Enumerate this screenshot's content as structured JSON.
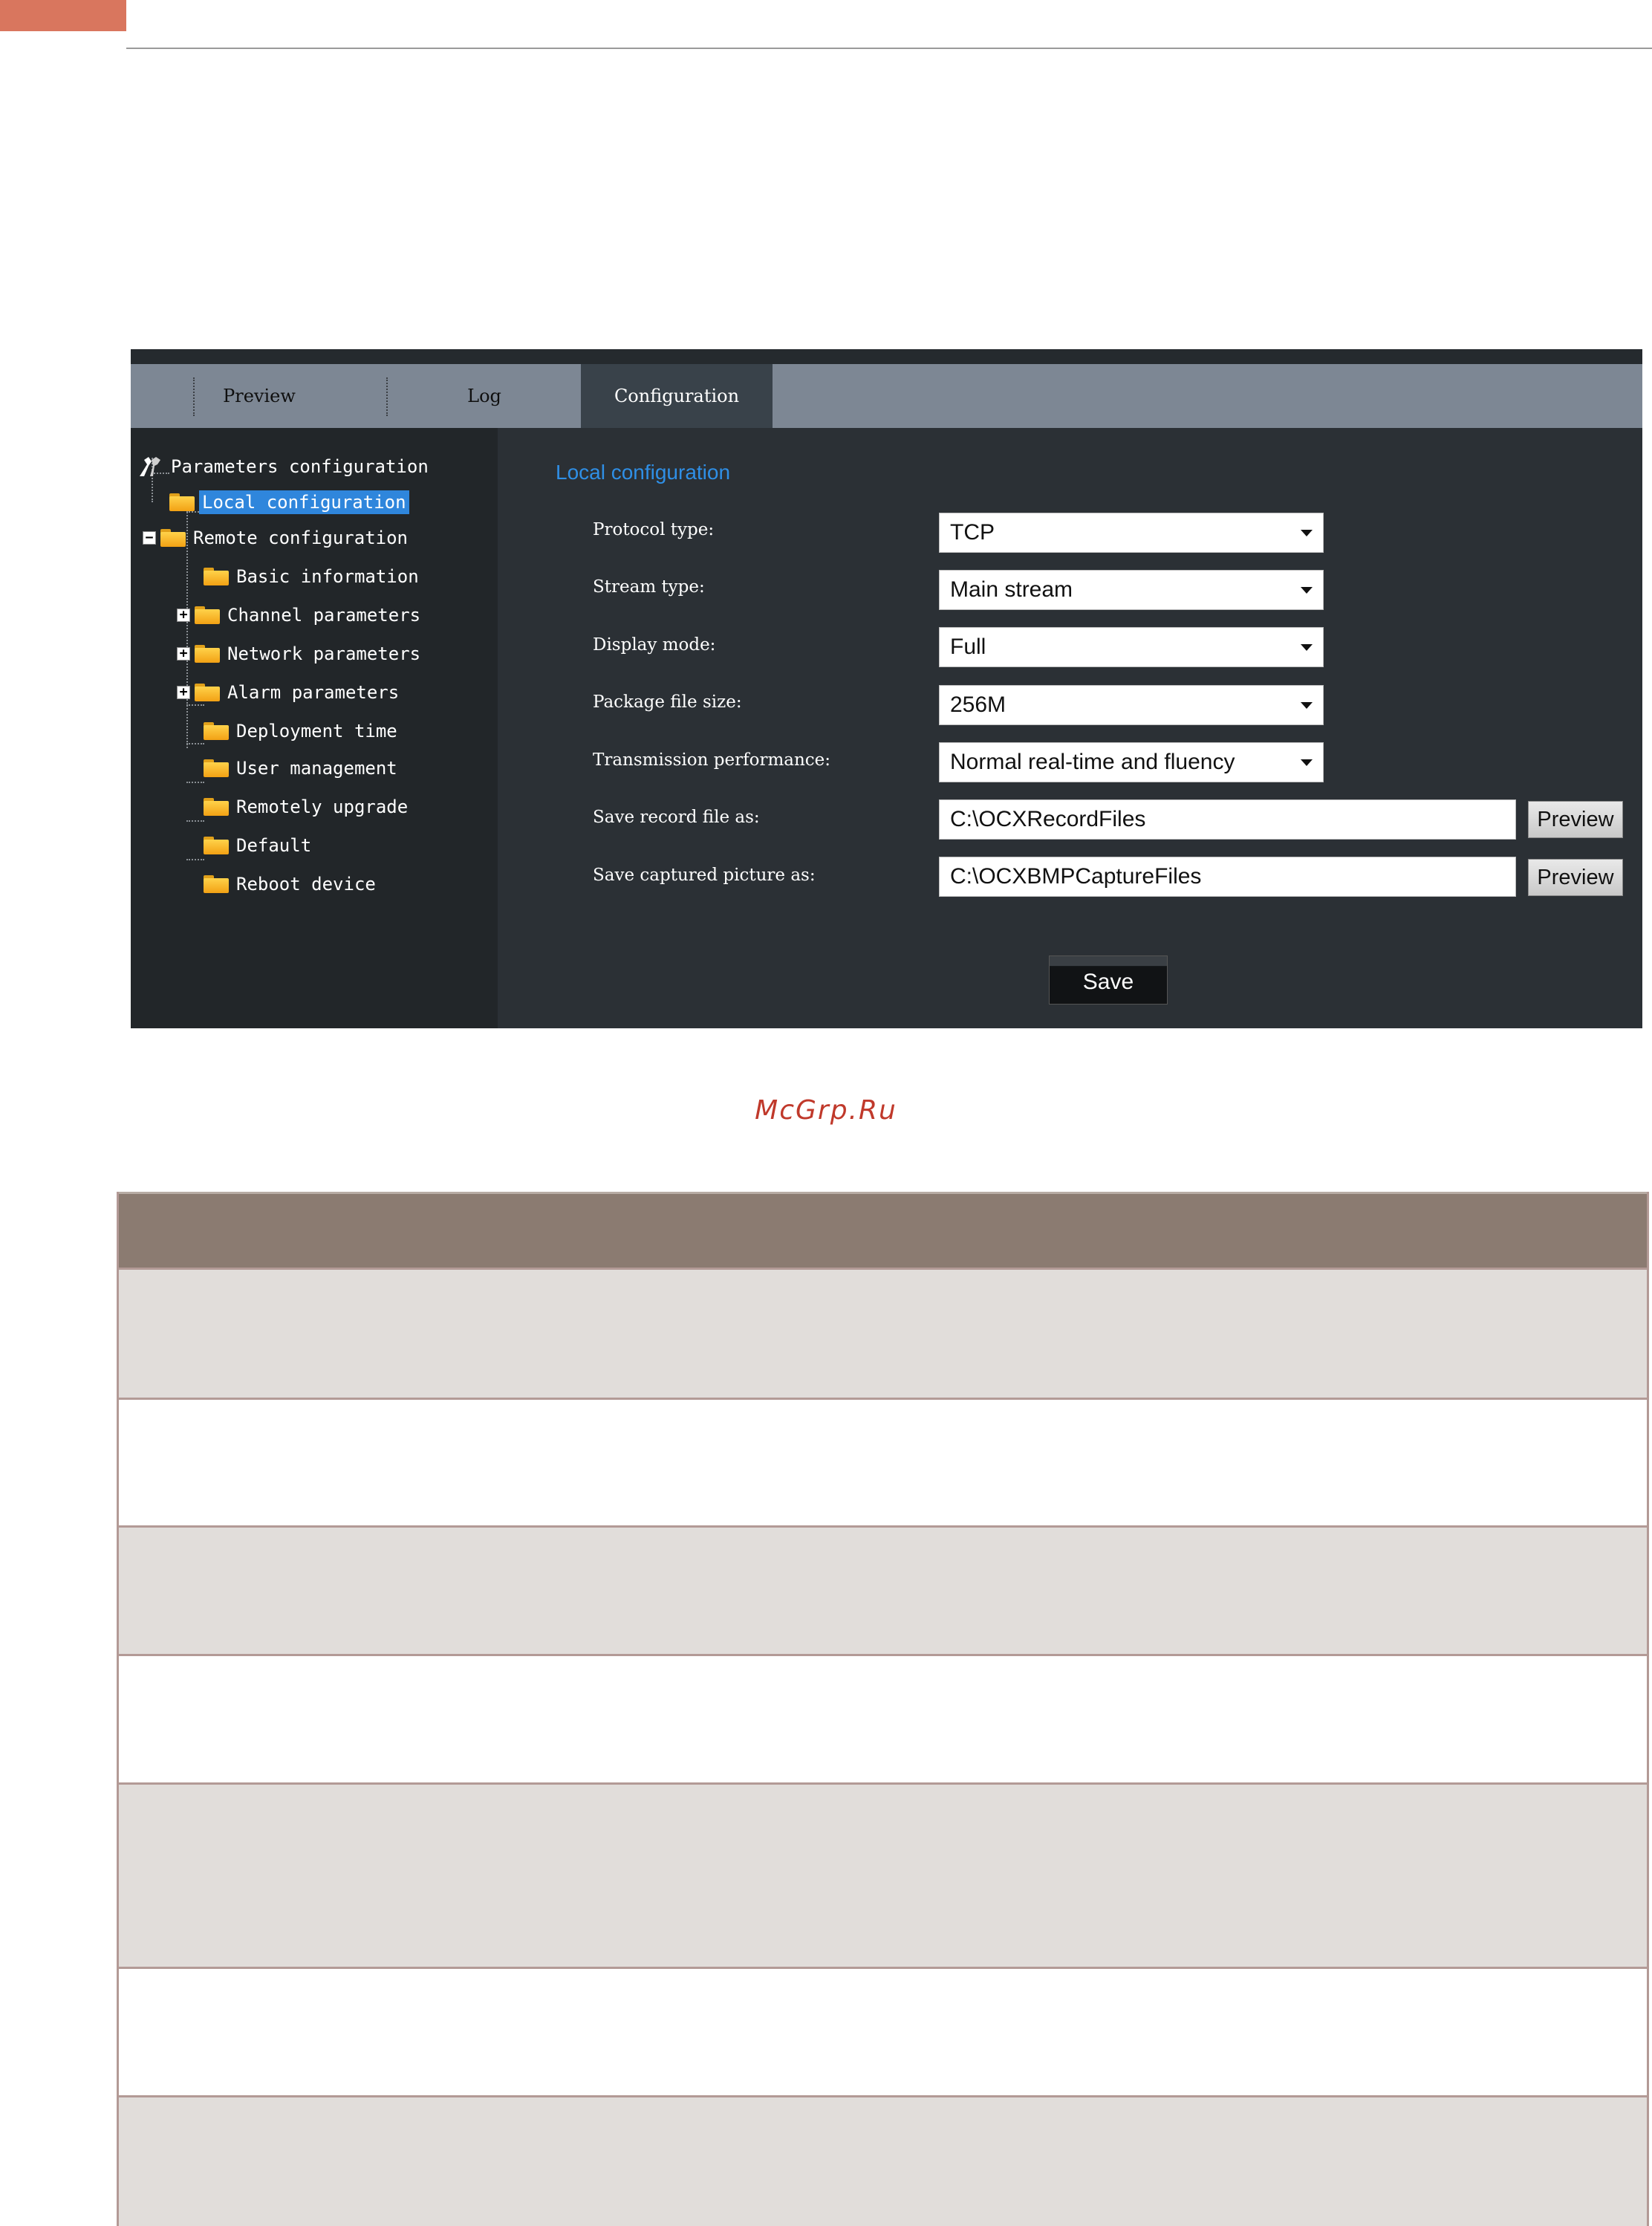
{
  "watermark": "McGrp.Ru",
  "tabs": [
    "Preview",
    "Log",
    "Configuration"
  ],
  "tree": {
    "root": "Parameters configuration",
    "items": [
      "Local configuration",
      "Remote configuration",
      "Basic information",
      "Channel parameters",
      "Network parameters",
      "Alarm parameters",
      "Deployment time",
      "User management",
      "Remotely upgrade",
      "Default",
      "Reboot device"
    ],
    "expanders": {
      "collapse": "−",
      "expand": "+"
    }
  },
  "content": {
    "title": "Local configuration",
    "fields": [
      {
        "label": "Protocol type:",
        "value": "TCP"
      },
      {
        "label": "Stream type:",
        "value": "Main stream"
      },
      {
        "label": "Display mode:",
        "value": "Full"
      },
      {
        "label": "Package file size:",
        "value": "256M"
      },
      {
        "label": "Transmission performance:",
        "value": "Normal real-time and fluency"
      },
      {
        "label": "Save record file as:",
        "value": "C:\\OCXRecordFiles"
      },
      {
        "label": "Save captured picture as:",
        "value": "C:\\OCXBMPCaptureFiles"
      }
    ],
    "preview_label": "Preview",
    "save_label": "Save"
  },
  "colors": {
    "accent_orange": "#d9765e",
    "selection_blue": "#2f86dc",
    "title_blue": "#2f8fe6",
    "table_header": "#8b7b71",
    "table_shade": "#e1ddda",
    "watermark_red": "#c0392b"
  },
  "icons": [
    "tools-icon",
    "folder-icon",
    "collapse-icon",
    "expand-icon",
    "dropdown-caret-icon"
  ]
}
